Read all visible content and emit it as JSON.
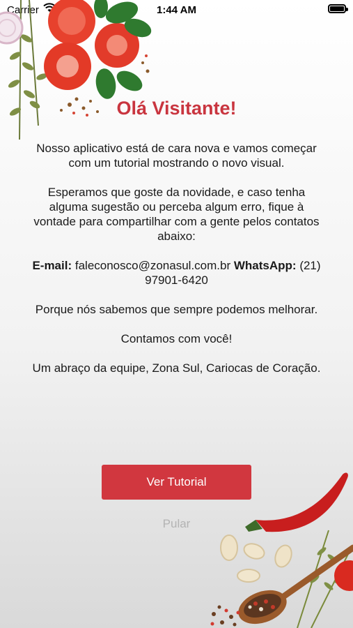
{
  "status_bar": {
    "carrier": "Carrier",
    "time": "1:44 AM"
  },
  "title": "Olá Visitante!",
  "paragraphs": {
    "intro": "Nosso aplicativo está de cara nova e vamos começar com um tutorial mostrando o novo visual.",
    "feedback": "Esperamos que goste da novidade, e caso tenha alguma sugestão ou perceba algum erro, fique à vontade para compartilhar com a gente pelos contatos abaixo:",
    "improve": "Porque nós sabemos que sempre podemos melhorar.",
    "count_on_you": "Contamos com você!",
    "signoff": "Um abraço da equipe, Zona Sul, Cariocas de Coração."
  },
  "contact": {
    "email_label": "E-mail:",
    "email_value": "faleconosco@zonasul.com.br",
    "whatsapp_label": "WhatsApp:",
    "whatsapp_value": "(21) 97901-6420"
  },
  "buttons": {
    "tutorial": "Ver Tutorial",
    "skip": "Pular"
  },
  "colors": {
    "accent": "#d1373f",
    "title": "#c9353f",
    "skip": "#b3b3b3"
  },
  "icons": {
    "wifi": "wifi-icon",
    "battery": "battery-icon"
  }
}
